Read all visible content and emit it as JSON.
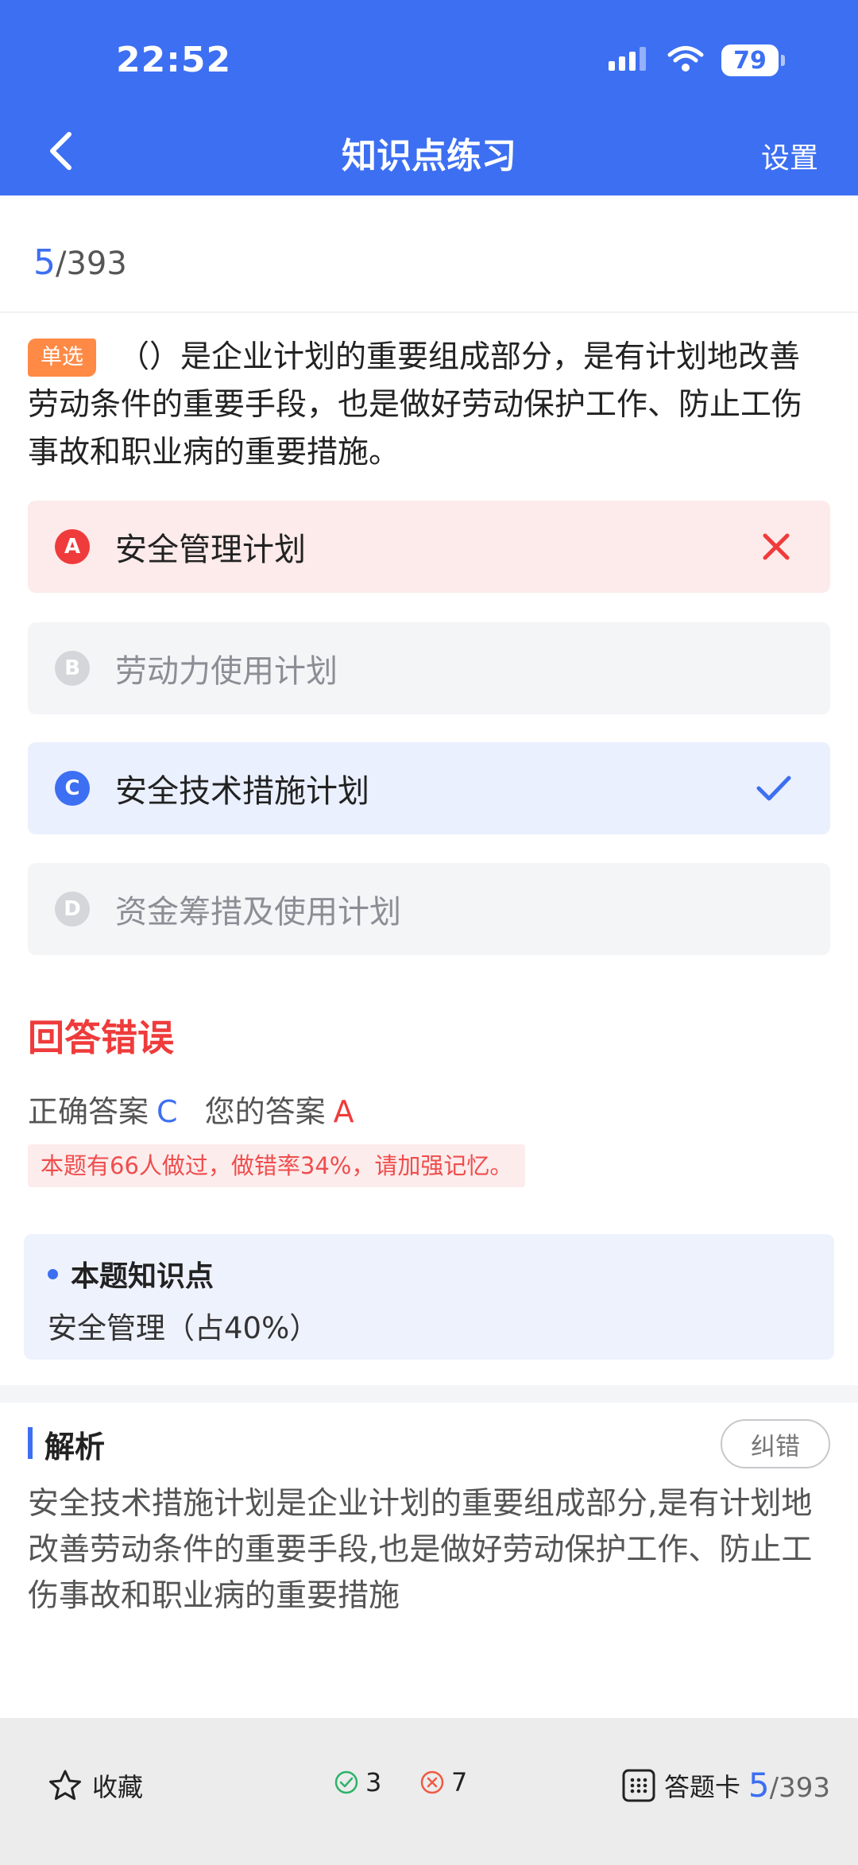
{
  "status_bar": {
    "time": "22:52",
    "battery": "79"
  },
  "header": {
    "title": "知识点练习",
    "settings_label": "设置"
  },
  "progress": {
    "current": "5",
    "total": "/393"
  },
  "question": {
    "type_tag": "单选",
    "text": "（）是企业计划的重要组成部分，是有计划地改善劳动条件的重要手段，也是做好劳动保护工作、防止工伤事故和职业病的重要措施。"
  },
  "options": [
    {
      "letter": "A",
      "text": "安全管理计划",
      "state": "wrong"
    },
    {
      "letter": "B",
      "text": "劳动力使用计划",
      "state": "normal"
    },
    {
      "letter": "C",
      "text": "安全技术措施计划",
      "state": "correct"
    },
    {
      "letter": "D",
      "text": "资金筹措及使用计划",
      "state": "normal"
    }
  ],
  "result": {
    "title": "回答错误",
    "correct_label": "正确答案",
    "correct_value": "C",
    "your_label": "您的答案",
    "your_value": "A",
    "stat_note": "本题有66人做过，做错率34%，请加强记忆。"
  },
  "knowledge": {
    "heading": "本题知识点",
    "value": "安全管理（占40%）"
  },
  "analysis": {
    "heading": "解析",
    "report_label": "纠错",
    "text": "安全技术措施计划是企业计划的重要组成部分,是有计划地改善劳动条件的重要手段,也是做好劳动保护工作、防止工伤事故和职业病的重要措施"
  },
  "bottom_bar": {
    "favorite_label": "收藏",
    "right_count": "3",
    "wrong_count": "7",
    "answer_card_label": "答题卡",
    "progress_current": "5",
    "progress_total": "/393"
  },
  "colors": {
    "primary": "#3d6ff2",
    "error": "#ef3b3b",
    "tag": "#ff8a45"
  }
}
